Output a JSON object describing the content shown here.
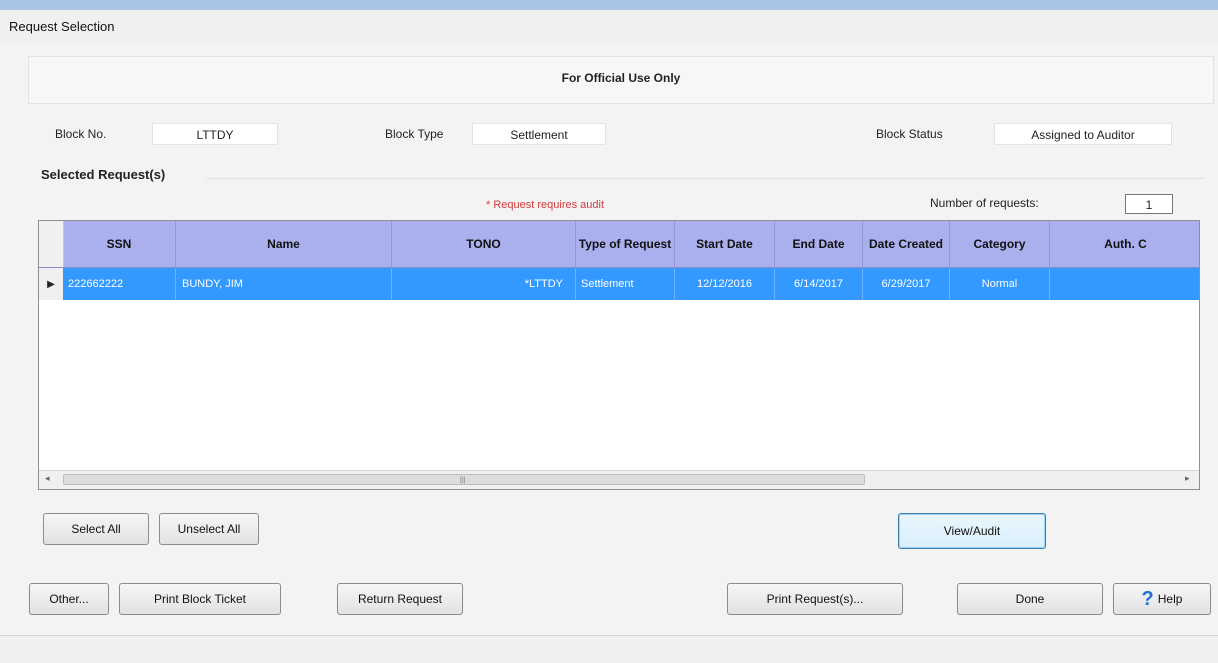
{
  "window": {
    "title": "Request Selection"
  },
  "header": {
    "official_text": "For Official Use Only"
  },
  "block": {
    "no_label": "Block No.",
    "no_value": "LTTDY",
    "type_label": "Block Type",
    "type_value": "Settlement",
    "status_label": "Block Status",
    "status_value": "Assigned to Auditor"
  },
  "selected": {
    "title": "Selected Request(s)",
    "audit_note": "* Request requires audit",
    "count_label": "Number of requests:",
    "count_value": "1"
  },
  "grid": {
    "columns": [
      "SSN",
      "Name",
      "TONO",
      "Type of Request",
      "Start Date",
      "End Date",
      "Date Created",
      "Category",
      "Auth. C"
    ],
    "rows": [
      {
        "ssn": "222662222",
        "name": "BUNDY, JIM",
        "tono": "*LTTDY",
        "type": "Settlement",
        "start": "12/12/2016",
        "end": "6/14/2017",
        "created": "6/29/2017",
        "category": "Normal",
        "auth": ""
      }
    ],
    "row_indicator": "▶",
    "scroll_left": "◂",
    "scroll_right": "▸",
    "scroll_grip": "|||"
  },
  "buttons": {
    "select_all": "Select All",
    "unselect_all": "Unselect All",
    "view_audit": "View/Audit",
    "other": "Other...",
    "print_block_ticket": "Print Block Ticket",
    "return_request": "Return Request",
    "print_requests": "Print Request(s)...",
    "done": "Done",
    "help": "Help",
    "help_icon": "?"
  },
  "colors": {
    "header_bg": "#aab0ee",
    "selected_row": "#3399ff",
    "audit_note": "#d23a3a"
  }
}
